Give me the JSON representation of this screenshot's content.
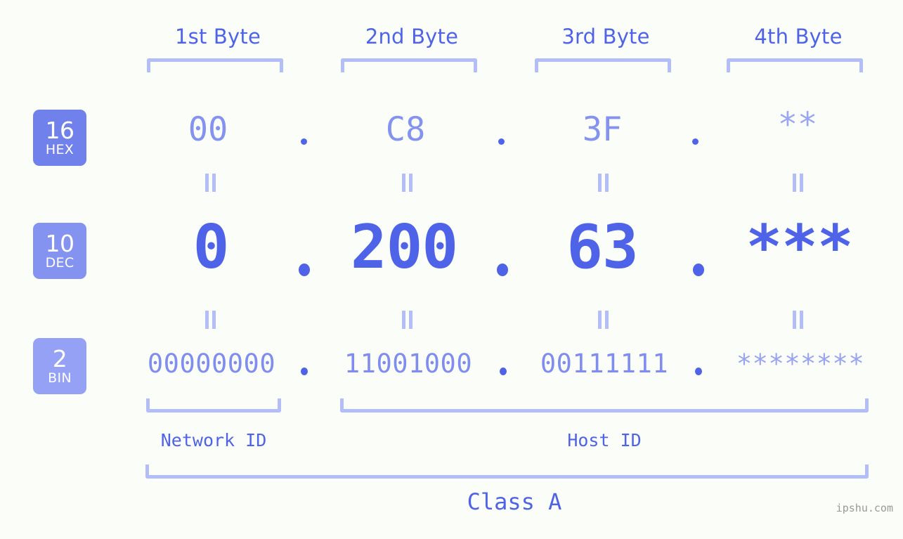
{
  "background_color": "#fbfdf8",
  "accent_color": "#4f63e8",
  "light_accent_color": "#b3bdf7",
  "byte_headers": [
    {
      "label": "1st Byte"
    },
    {
      "label": "2nd Byte"
    },
    {
      "label": "3rd Byte"
    },
    {
      "label": "4th Byte"
    }
  ],
  "rows": [
    {
      "key": "hex",
      "badge_number": "16",
      "badge_name": "HEX",
      "badge_color": "#7181ec",
      "values": [
        "00",
        "C8",
        "3F",
        "**"
      ],
      "masked": [
        false,
        false,
        false,
        true
      ],
      "separator": "."
    },
    {
      "key": "dec",
      "badge_number": "10",
      "badge_name": "DEC",
      "badge_color": "#8492f0",
      "values": [
        "0",
        "200",
        "63",
        "***"
      ],
      "masked": [
        false,
        false,
        false,
        true
      ],
      "separator": "."
    },
    {
      "key": "bin",
      "badge_number": "2",
      "badge_name": "BIN",
      "badge_color": "#94a1f5",
      "values": [
        "00000000",
        "11001000",
        "00111111",
        "********"
      ],
      "masked": [
        false,
        false,
        false,
        true
      ],
      "separator": "."
    }
  ],
  "equals_symbol": "=",
  "segments": [
    {
      "label": "Network ID"
    },
    {
      "label": "Host ID"
    }
  ],
  "class_label": "Class A",
  "watermark": "ipshu.com"
}
